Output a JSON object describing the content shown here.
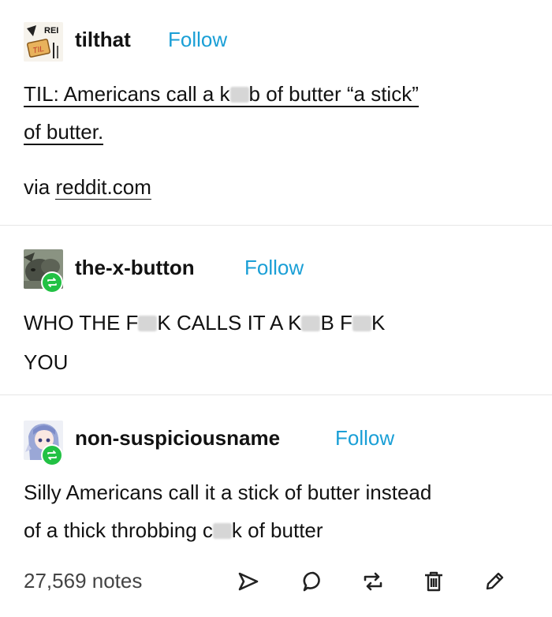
{
  "posts": [
    {
      "username": "tilthat",
      "follow": "Follow",
      "avatar_text": [
        "REI",
        "TIL"
      ],
      "segments": [
        "TIL: Americans call a k",
        "b of butter “a stick”",
        "of butter."
      ],
      "via_prefix": "via ",
      "via_link": "reddit.com"
    },
    {
      "username": "the-x-button",
      "follow": "Follow",
      "segments": [
        "WHO THE F",
        "K CALLS IT A K",
        "B F",
        "K",
        "YOU"
      ]
    },
    {
      "username": "non-suspiciousname",
      "follow": "Follow",
      "segments": [
        "Silly Americans call it a stick of butter instead",
        "of a thick throbbing c",
        "k of butter"
      ]
    }
  ],
  "footer": {
    "notes": "27,569 notes",
    "icons": [
      "share-icon",
      "reply-icon",
      "reblog-icon",
      "delete-icon",
      "edit-icon"
    ]
  },
  "colors": {
    "follow": "#1a9fd6",
    "reblog_badge": "#22c144",
    "divider": "#e6e6e6"
  }
}
